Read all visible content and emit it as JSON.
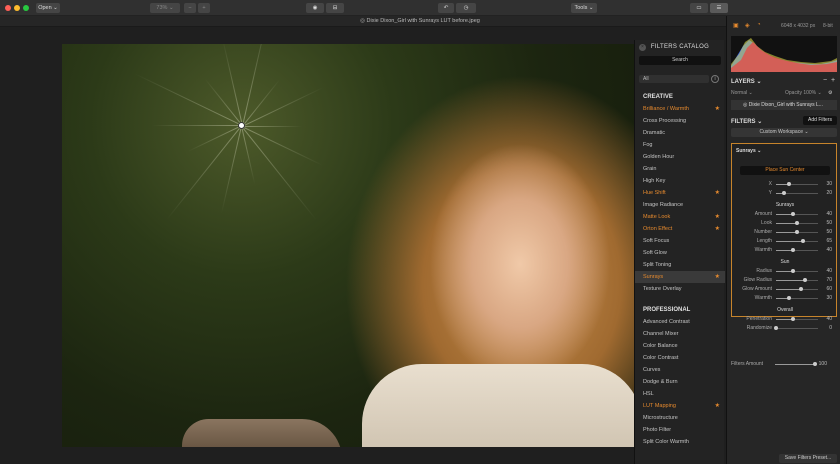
{
  "titlebar": {
    "open_label": "Open ⌄",
    "zoom_label": "73% ⌄",
    "tools_label": "Tools ⌄"
  },
  "document": {
    "title": "◎ Dixie Dixon_Girl with Sunrays LUT before.jpeg"
  },
  "catalog": {
    "title": "FILTERS CATALOG",
    "search": "Search",
    "filter_select": "All",
    "info": "i",
    "creative_header": "CREATIVE",
    "creative": [
      {
        "label": "Brilliance / Warmth",
        "fav": true
      },
      {
        "label": "Cross Processing",
        "fav": false
      },
      {
        "label": "Dramatic",
        "fav": false
      },
      {
        "label": "Fog",
        "fav": false
      },
      {
        "label": "Golden Hour",
        "fav": false
      },
      {
        "label": "Grain",
        "fav": false
      },
      {
        "label": "High Key",
        "fav": false
      },
      {
        "label": "Hue Shift",
        "fav": true
      },
      {
        "label": "Image Radiance",
        "fav": false
      },
      {
        "label": "Matte Look",
        "fav": true
      },
      {
        "label": "Orton Effect",
        "fav": true
      },
      {
        "label": "Soft Focus",
        "fav": false
      },
      {
        "label": "Soft Glow",
        "fav": false
      },
      {
        "label": "Split Toning",
        "fav": false
      },
      {
        "label": "Sunrays",
        "fav": true,
        "selected": true
      },
      {
        "label": "Texture Overlay",
        "fav": false
      }
    ],
    "professional_header": "PROFESSIONAL",
    "professional": [
      {
        "label": "Advanced Contrast",
        "fav": false
      },
      {
        "label": "Channel Mixer",
        "fav": false
      },
      {
        "label": "Color Balance",
        "fav": false
      },
      {
        "label": "Color Contrast",
        "fav": false
      },
      {
        "label": "Curves",
        "fav": false
      },
      {
        "label": "Dodge & Burn",
        "fav": false
      },
      {
        "label": "HSL",
        "fav": false
      },
      {
        "label": "LUT Mapping",
        "fav": true
      },
      {
        "label": "Microstructure",
        "fav": false
      },
      {
        "label": "Photo Filter",
        "fav": false
      },
      {
        "label": "Split Color Warmth",
        "fav": false
      }
    ]
  },
  "panel": {
    "image_info": "6048 x 4032 px",
    "bit_depth": "8-bit",
    "layers_header": "LAYERS ⌄",
    "blend": "Normal ⌄",
    "opacity": "Opacity 100% ⌄",
    "layer_name": "◎ Dixie Dixon_Girl with Sunrays L...",
    "filters_header": "FILTERS ⌄",
    "add_filters": "Add Filters",
    "workspace": "Custom Workspace ⌄",
    "filter_name": "Sunrays ⌄",
    "place_sun": "Place Sun Center",
    "xy": [
      {
        "label": "X",
        "value": 30
      },
      {
        "label": "Y",
        "value": 20
      }
    ],
    "sunrays_header": "Sunrays",
    "sunrays": [
      {
        "label": "Amount",
        "value": 40
      },
      {
        "label": "Look",
        "value": 50
      },
      {
        "label": "Number",
        "value": 50
      },
      {
        "label": "Length",
        "value": 65
      },
      {
        "label": "Warmth",
        "value": 40
      }
    ],
    "sun_header": "Sun",
    "sun": [
      {
        "label": "Radius",
        "value": 40
      },
      {
        "label": "Glow Radius",
        "value": 70
      },
      {
        "label": "Glow Amount",
        "value": 60
      },
      {
        "label": "Warmth",
        "value": 30
      }
    ],
    "overall_header": "Overall",
    "overall": [
      {
        "label": "Penetration",
        "value": 40
      },
      {
        "label": "Randomize",
        "value": 0
      }
    ],
    "filters_amount": {
      "label": "Filters Amount",
      "value": 100
    },
    "save_preset": "Save Filters Preset..."
  },
  "colors": {
    "accent": "#e68a2e"
  }
}
